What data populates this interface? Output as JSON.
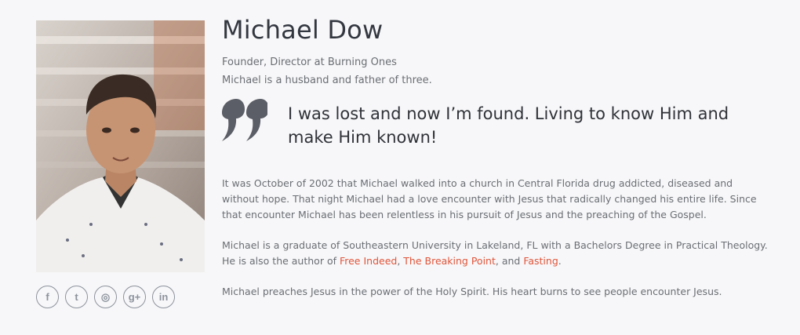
{
  "profile": {
    "name": "Michael Dow",
    "role": "Founder, Director at Burning Ones",
    "family": "Michael is a husband and father of three.",
    "quote": "I was lost and now I’m found. Living to know Him and make Him known!"
  },
  "bio": {
    "p1": "It was October of 2002 that Michael walked into a church in Central Florida drug addicted, diseased and without hope. That night Michael had a love encounter with Jesus that radically changed his entire life. Since that encounter Michael has been relentless in his pursuit of Jesus and the preaching of the Gospel.",
    "p2_before": "Michael is a graduate of Southeastern University in Lakeland, FL with a Bachelors Degree in Practical Theology. He is also the author of ",
    "book1": "Free Indeed",
    "sep1": ", ",
    "book2": "The Breaking Point",
    "sep2": ", and ",
    "book3": "Fasting",
    "p2_after": ".",
    "p3": "Michael preaches Jesus in the power of the Holy Spirit. His heart burns to see people encounter Jesus."
  },
  "social": [
    {
      "icon": "facebook-icon",
      "glyph": "f"
    },
    {
      "icon": "twitter-icon",
      "glyph": "t"
    },
    {
      "icon": "instagram-icon",
      "glyph": "◎"
    },
    {
      "icon": "google-plus-icon",
      "glyph": "g+"
    },
    {
      "icon": "linkedin-icon",
      "glyph": "in"
    }
  ],
  "colors": {
    "accent_link": "#e0553a",
    "heading": "#333740",
    "body_text": "#6a6e73",
    "icon_border": "#8c929c",
    "background": "#f7f7f9"
  }
}
